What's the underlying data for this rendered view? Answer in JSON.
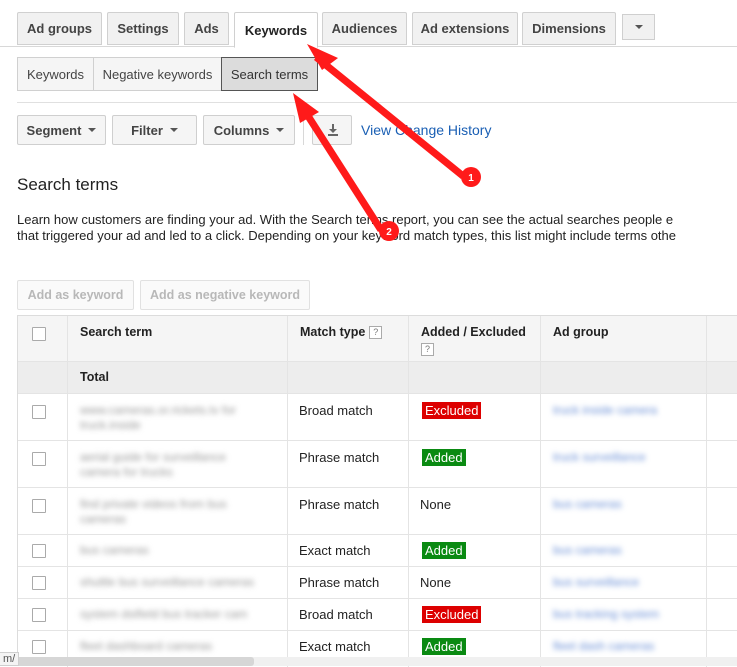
{
  "tabs": [
    "Ad groups",
    "Settings",
    "Ads",
    "Keywords",
    "Audiences",
    "Ad extensions",
    "Dimensions"
  ],
  "active_tab": "Keywords",
  "subtabs": [
    "Keywords",
    "Negative keywords",
    "Search terms"
  ],
  "active_subtab": "Search terms",
  "toolbar": {
    "segment": "Segment",
    "filter": "Filter",
    "columns": "Columns",
    "change_history": "View Change History"
  },
  "section_title": "Search terms",
  "description": {
    "line1": "Learn how customers are finding your ad. With the Search terms report, you can see the actual searches people e",
    "line2": "that triggered your ad and led to a click. Depending on your keyword match types, this list might include terms othe"
  },
  "buttons": {
    "add_keyword": "Add as keyword",
    "add_negative": "Add as negative keyword"
  },
  "table": {
    "headers": {
      "search_term": "Search term",
      "match_type": "Match type",
      "added_excluded": "Added / Excluded",
      "ad_group": "Ad group"
    },
    "qmark": "?",
    "total_label": "Total",
    "rows": [
      {
        "term": "www.cameras.or.rickets.tv for truck.inside",
        "match": "Broad match",
        "status": "Excluded",
        "group": "truck inside camera"
      },
      {
        "term": "aerial guide for surveillance camera for trucks",
        "match": "Phrase match",
        "status": "Added",
        "group": "truck surveillance"
      },
      {
        "term": "find private videos from bus cameras",
        "match": "Phrase match",
        "status": "None",
        "group": "bus cameras"
      },
      {
        "term": "bus cameras",
        "match": "Exact match",
        "status": "Added",
        "group": "bus cameras"
      },
      {
        "term": "shuttle bus surveillance cameras",
        "match": "Phrase match",
        "status": "None",
        "group": "bus surveillance"
      },
      {
        "term": "system dsifield bus tracker cam",
        "match": "Broad match",
        "status": "Excluded",
        "group": "bus tracking system"
      },
      {
        "term": "fleet dashboard cameras",
        "match": "Exact match",
        "status": "Added",
        "group": "fleet dash cameras"
      }
    ]
  },
  "annotations": {
    "marker1": "1",
    "marker2": "2",
    "arrow_color": "#ff1a1a"
  },
  "status_url": "m/"
}
